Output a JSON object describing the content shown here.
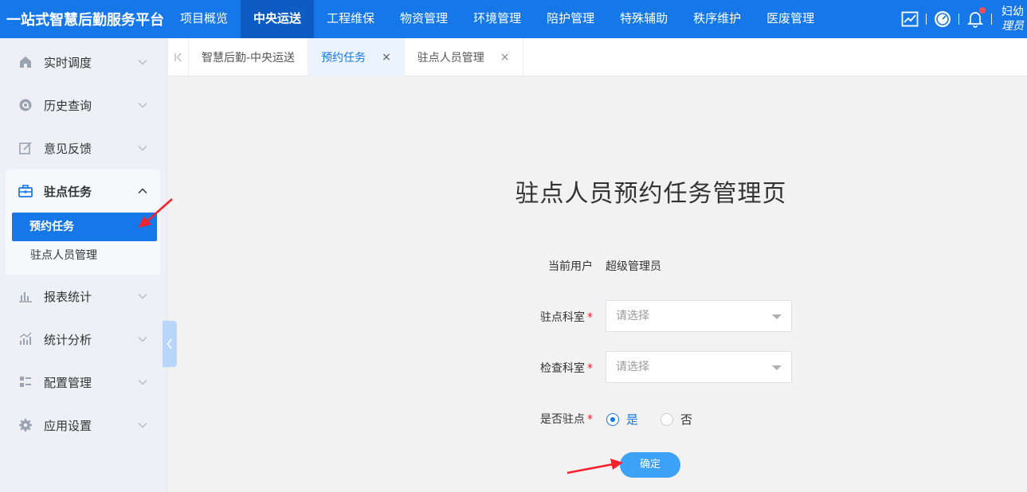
{
  "brand": "一站式智慧后勤服务平台",
  "nav": [
    "项目概览",
    "中央运送",
    "工程维保",
    "物资管理",
    "环境管理",
    "陪护管理",
    "特殊辅助",
    "秩序维护",
    "医废管理"
  ],
  "nav_active": 1,
  "user": {
    "line1": "妇幼",
    "line2": "理员"
  },
  "sidebar": {
    "items_top": [
      {
        "label": "实时调度",
        "icon": "home-icon"
      },
      {
        "label": "历史查询",
        "icon": "history-icon"
      },
      {
        "label": "意见反馈",
        "icon": "edit-icon"
      }
    ],
    "group": {
      "label": "驻点任务",
      "icon": "briefcase-icon",
      "children": [
        "预约任务",
        "驻点人员管理"
      ],
      "active_child": 0
    },
    "items_bottom": [
      {
        "label": "报表统计",
        "icon": "bar-chart-icon"
      },
      {
        "label": "统计分析",
        "icon": "analysis-icon"
      },
      {
        "label": "配置管理",
        "icon": "config-icon"
      },
      {
        "label": "应用设置",
        "icon": "settings-icon"
      }
    ]
  },
  "tabs": [
    {
      "label": "智慧后勤-中央运送",
      "closable": false
    },
    {
      "label": "预约任务",
      "closable": true,
      "active": true
    },
    {
      "label": "驻点人员管理",
      "closable": true
    }
  ],
  "tab_close_glyph": "×",
  "page": {
    "title": "驻点人员预约任务管理页",
    "current_user_label": "当前用户",
    "current_user_value": "超级管理员",
    "dept_label": "驻点科室",
    "dept_placeholder": "请选择",
    "check_label": "检查科室",
    "check_placeholder": "请选择",
    "station_label": "是否驻点",
    "required_mark": "*",
    "radio_yes": "是",
    "radio_no": "否",
    "selected": "yes",
    "confirm": "确定"
  },
  "colors": {
    "primary": "#1677e8",
    "nav_active": "#0e5bc4",
    "button": "#3da2f5",
    "arrow": "#f5222d"
  }
}
